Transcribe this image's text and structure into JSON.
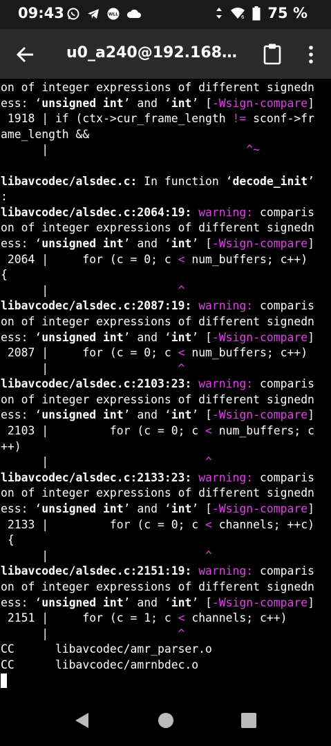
{
  "status_bar": {
    "time": "09:43",
    "battery_percent": "75 %",
    "icons": [
      "whatsapp-icon",
      "telegram-icon",
      "wll-app-icon",
      "cloud-icon",
      "data-arrows-icon",
      "wifi-icon",
      "battery-icon"
    ]
  },
  "app_bar": {
    "title": "u0_a240@192.168…",
    "icons": [
      "back-arrow-icon",
      "clipboard-icon",
      "overflow-menu-icon"
    ]
  },
  "terminal": {
    "lines": [
      [
        {
          "t": "on of integer expressions of different signedn"
        }
      ],
      [
        {
          "t": "ess: ‘"
        },
        {
          "t": "unsigned int",
          "s": "b"
        },
        {
          "t": "’ and ‘"
        },
        {
          "t": "int",
          "s": "b"
        },
        {
          "t": "’ ["
        },
        {
          "t": "-Wsign-compare",
          "s": "m"
        },
        {
          "t": "]"
        }
      ],
      [
        {
          "t": " 1918 | if (ctx->cur_frame_length "
        },
        {
          "t": "!=",
          "s": "m"
        },
        {
          "t": " sconf->fr"
        }
      ],
      [
        {
          "t": "ame_length &&"
        }
      ],
      [
        {
          "t": "      |                             "
        },
        {
          "t": "^~",
          "s": "m"
        }
      ],
      [
        {
          "t": ""
        }
      ],
      [
        {
          "t": "libavcodec/alsdec.c:",
          "s": "b"
        },
        {
          "t": " In function ‘"
        },
        {
          "t": "decode_init",
          "s": "b"
        },
        {
          "t": "’"
        }
      ],
      [
        {
          "t": ":"
        }
      ],
      [
        {
          "t": "libavcodec/alsdec.c:2064:19:",
          "s": "b"
        },
        {
          "t": " "
        },
        {
          "t": "warning:",
          "s": "m"
        },
        {
          "t": " comparis"
        }
      ],
      [
        {
          "t": "on of integer expressions of different signedn"
        }
      ],
      [
        {
          "t": "ess: ‘"
        },
        {
          "t": "unsigned int",
          "s": "b"
        },
        {
          "t": "’ and ‘"
        },
        {
          "t": "int",
          "s": "b"
        },
        {
          "t": "’ ["
        },
        {
          "t": "-Wsign-compare",
          "s": "m"
        },
        {
          "t": "]"
        }
      ],
      [
        {
          "t": " 2064 |     for (c = 0; c "
        },
        {
          "t": "<",
          "s": "m"
        },
        {
          "t": " num_buffers; c++)"
        }
      ],
      [
        {
          "t": "{"
        }
      ],
      [
        {
          "t": "      |                   "
        },
        {
          "t": "^",
          "s": "m"
        }
      ],
      [
        {
          "t": "libavcodec/alsdec.c:2087:19:",
          "s": "b"
        },
        {
          "t": " "
        },
        {
          "t": "warning:",
          "s": "m"
        },
        {
          "t": " comparis"
        }
      ],
      [
        {
          "t": "on of integer expressions of different signedn"
        }
      ],
      [
        {
          "t": "ess: ‘"
        },
        {
          "t": "unsigned int",
          "s": "b"
        },
        {
          "t": "’ and ‘"
        },
        {
          "t": "int",
          "s": "b"
        },
        {
          "t": "’ ["
        },
        {
          "t": "-Wsign-compare",
          "s": "m"
        },
        {
          "t": "]"
        }
      ],
      [
        {
          "t": " 2087 |     for (c = 0; c "
        },
        {
          "t": "<",
          "s": "m"
        },
        {
          "t": " num_buffers; c++)"
        }
      ],
      [
        {
          "t": "      |                   "
        },
        {
          "t": "^",
          "s": "m"
        }
      ],
      [
        {
          "t": "libavcodec/alsdec.c:2103:23:",
          "s": "b"
        },
        {
          "t": " "
        },
        {
          "t": "warning:",
          "s": "m"
        },
        {
          "t": " comparis"
        }
      ],
      [
        {
          "t": "on of integer expressions of different signedn"
        }
      ],
      [
        {
          "t": "ess: ‘"
        },
        {
          "t": "unsigned int",
          "s": "b"
        },
        {
          "t": "’ and ‘"
        },
        {
          "t": "int",
          "s": "b"
        },
        {
          "t": "’ ["
        },
        {
          "t": "-Wsign-compare",
          "s": "m"
        },
        {
          "t": "]"
        }
      ],
      [
        {
          "t": " 2103 |         for (c = 0; c "
        },
        {
          "t": "<",
          "s": "m"
        },
        {
          "t": " num_buffers; c"
        }
      ],
      [
        {
          "t": "++)"
        }
      ],
      [
        {
          "t": "      |                       "
        },
        {
          "t": "^",
          "s": "m"
        }
      ],
      [
        {
          "t": "libavcodec/alsdec.c:2133:23:",
          "s": "b"
        },
        {
          "t": " "
        },
        {
          "t": "warning:",
          "s": "m"
        },
        {
          "t": " comparis"
        }
      ],
      [
        {
          "t": "on of integer expressions of different signedn"
        }
      ],
      [
        {
          "t": "ess: ‘"
        },
        {
          "t": "unsigned int",
          "s": "b"
        },
        {
          "t": "’ and ‘"
        },
        {
          "t": "int",
          "s": "b"
        },
        {
          "t": "’ ["
        },
        {
          "t": "-Wsign-compare",
          "s": "m"
        },
        {
          "t": "]"
        }
      ],
      [
        {
          "t": " 2133 |         for (c = 0; c "
        },
        {
          "t": "<",
          "s": "m"
        },
        {
          "t": " channels; ++c)"
        }
      ],
      [
        {
          "t": " {"
        }
      ],
      [
        {
          "t": "      |                       "
        },
        {
          "t": "^",
          "s": "m"
        }
      ],
      [
        {
          "t": "libavcodec/alsdec.c:2151:19:",
          "s": "b"
        },
        {
          "t": " "
        },
        {
          "t": "warning:",
          "s": "m"
        },
        {
          "t": " comparis"
        }
      ],
      [
        {
          "t": "on of integer expressions of different signedn"
        }
      ],
      [
        {
          "t": "ess: ‘"
        },
        {
          "t": "unsigned int",
          "s": "b"
        },
        {
          "t": "’ and ‘"
        },
        {
          "t": "int",
          "s": "b"
        },
        {
          "t": "’ ["
        },
        {
          "t": "-Wsign-compare",
          "s": "m"
        },
        {
          "t": "]"
        }
      ],
      [
        {
          "t": " 2151 |     for (c = 1; c "
        },
        {
          "t": "<",
          "s": "m"
        },
        {
          "t": " channels; c++)"
        }
      ],
      [
        {
          "t": "      |                   "
        },
        {
          "t": "^",
          "s": "m"
        }
      ],
      [
        {
          "t": "CC      libavcodec/amr_parser.o"
        }
      ],
      [
        {
          "t": "CC      libavcodec/amrnbdec.o"
        }
      ]
    ],
    "cursor_visible": true
  },
  "nav_bar": {
    "icons": [
      "back-triangle-icon",
      "home-circle-icon",
      "recents-square-icon"
    ]
  }
}
